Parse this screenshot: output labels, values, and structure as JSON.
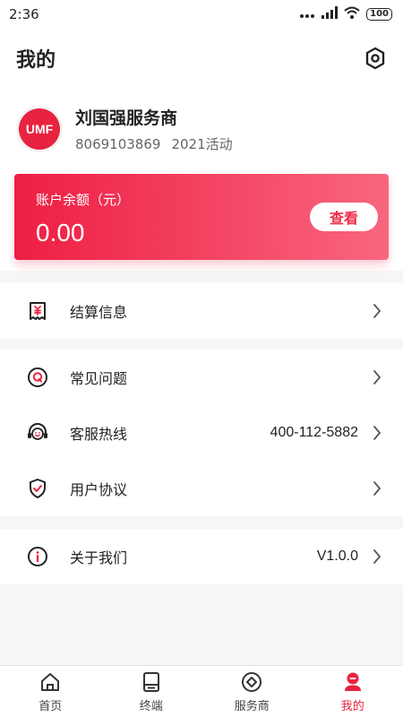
{
  "status_bar": {
    "time": "2:36",
    "battery": "100"
  },
  "header": {
    "title": "我的"
  },
  "profile": {
    "logo_text": "UMF",
    "name": "刘国强服务商",
    "account_id": "8069103869",
    "campaign": "2021活动"
  },
  "balance": {
    "label": "账户余额（元）",
    "value": "0.00",
    "view_button": "查看"
  },
  "menu": {
    "settlement": {
      "label": "结算信息"
    },
    "faq": {
      "label": "常见问题"
    },
    "hotline": {
      "label": "客服热线",
      "value": "400-112-5882"
    },
    "agreement": {
      "label": "用户协议"
    },
    "about": {
      "label": "关于我们",
      "value": "V1.0.0"
    }
  },
  "tabs": [
    {
      "label": "首页",
      "icon": "home-icon"
    },
    {
      "label": "终端",
      "icon": "terminal-icon"
    },
    {
      "label": "服务商",
      "icon": "provider-icon"
    },
    {
      "label": "我的",
      "icon": "profile-icon"
    }
  ],
  "colors": {
    "brand": "#e8233f",
    "card_start": "#ee1e44",
    "card_end": "#f9667e",
    "background": "#f6f6f6"
  }
}
